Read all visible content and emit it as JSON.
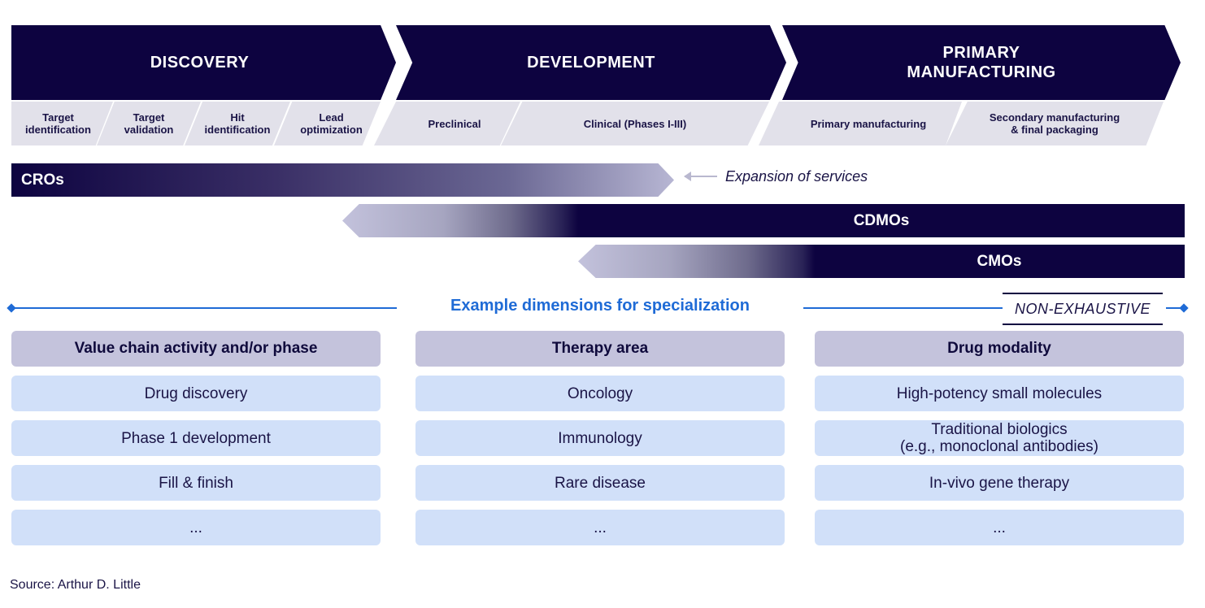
{
  "phases": [
    {
      "label": "DISCOVERY",
      "steps": [
        "Target identification",
        "Target validation",
        "Hit identification",
        "Lead optimization"
      ]
    },
    {
      "label": "DEVELOPMENT",
      "steps": [
        "Preclinical",
        "Clinical (Phases I-III)"
      ]
    },
    {
      "label_line1": "PRIMARY",
      "label_line2": "MANUFACTURING",
      "steps": [
        "Primary manufacturing",
        "Secondary manufacturing & final packaging"
      ]
    }
  ],
  "steps_split": {
    "target_identification": [
      "Target",
      "identification"
    ],
    "target_validation": [
      "Target",
      "validation"
    ],
    "hit_identification": [
      "Hit",
      "identification"
    ],
    "lead_optimization": [
      "Lead",
      "optimization"
    ],
    "secondary_manufacturing": [
      "Secondary manufacturing",
      "& final packaging"
    ]
  },
  "providers": {
    "cros": "CROs",
    "cdmos": "CDMOs",
    "cmos": "CMOs",
    "expansion_label": "Expansion of services"
  },
  "section": {
    "title": "Example dimensions for specialization",
    "tag": "NON-EXHAUSTIVE"
  },
  "columns": [
    {
      "header": "Value chain activity and/or phase",
      "items": [
        "Drug discovery",
        "Phase 1 development",
        "Fill & finish",
        "..."
      ]
    },
    {
      "header": "Therapy area",
      "items": [
        "Oncology",
        "Immunology",
        "Rare disease",
        "..."
      ]
    },
    {
      "header": "Drug modality",
      "items": [
        "High-potency small molecules",
        "Traditional biologics",
        "(e.g., monoclonal antibodies)",
        "In-vivo gene therapy",
        "..."
      ]
    }
  ],
  "source": "Source: Arthur D. Little",
  "colors": {
    "navy": "#0d0340",
    "sub_gray": "#e2e1ea",
    "accent_blue": "#1f6bd6",
    "header_lavender": "#c4c3dc",
    "item_blue": "#d1e0f9"
  }
}
